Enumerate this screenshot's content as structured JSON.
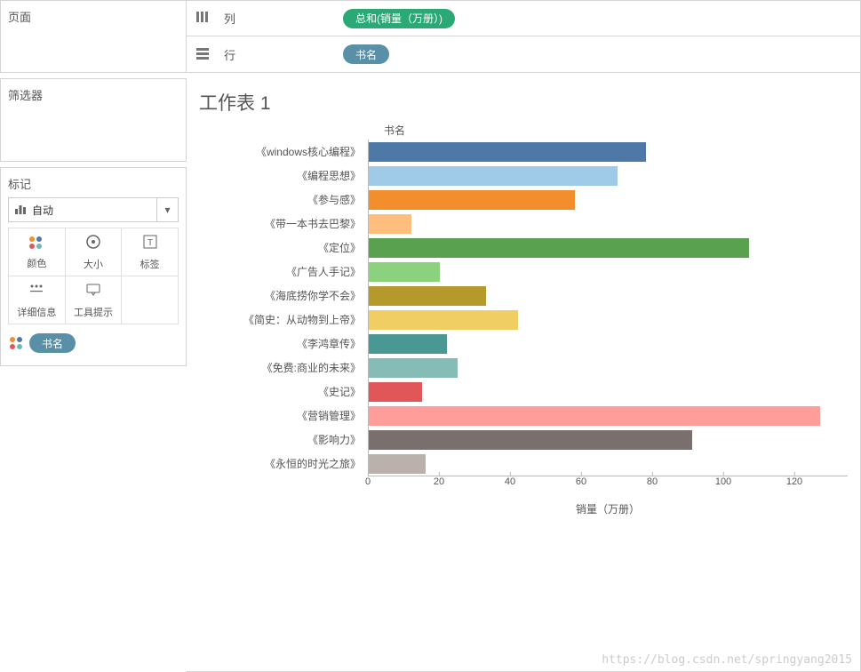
{
  "sidebar": {
    "pages_title": "页面",
    "filters_title": "筛选器",
    "marks_title": "标记",
    "dropdown_label": "自动",
    "marks_cells": {
      "color": "颜色",
      "size": "大小",
      "label": "标签",
      "detail": "详细信息",
      "tooltip": "工具提示"
    },
    "color_pill": "书名"
  },
  "shelves": {
    "columns_label": "列",
    "columns_pill": "总和(销量（万册）)",
    "rows_label": "行",
    "rows_pill": "书名"
  },
  "viz": {
    "sheet_title": "工作表 1",
    "category_header": "书名",
    "x_axis_label": "销量（万册）"
  },
  "watermark": "https://blog.csdn.net/springyang2015",
  "chart_data": {
    "type": "bar",
    "orientation": "horizontal",
    "title": "工作表 1",
    "xlabel": "销量（万册）",
    "ylabel": "书名",
    "xlim": [
      0,
      130
    ],
    "xticks": [
      0,
      20,
      40,
      60,
      80,
      100,
      120
    ],
    "categories": [
      "《windows核心编程》",
      "《编程思想》",
      "《参与感》",
      "《带一本书去巴黎》",
      "《定位》",
      "《广告人手记》",
      "《海底捞你学不会》",
      "《简史：从动物到上帝》",
      "《李鸿章传》",
      "《免费:商业的未来》",
      "《史记》",
      "《营销管理》",
      "《影响力》",
      "《永恒的时光之旅》"
    ],
    "values": [
      78,
      70,
      58,
      12,
      107,
      20,
      33,
      42,
      22,
      25,
      15,
      127,
      91,
      16
    ],
    "colors": [
      "#4e79a7",
      "#a0cbe8",
      "#f28e2b",
      "#ffbe7d",
      "#59a14f",
      "#8cd17d",
      "#b6992d",
      "#f1ce63",
      "#499894",
      "#86bcb6",
      "#e15759",
      "#ff9d9a",
      "#79706e",
      "#bab0ac"
    ]
  }
}
